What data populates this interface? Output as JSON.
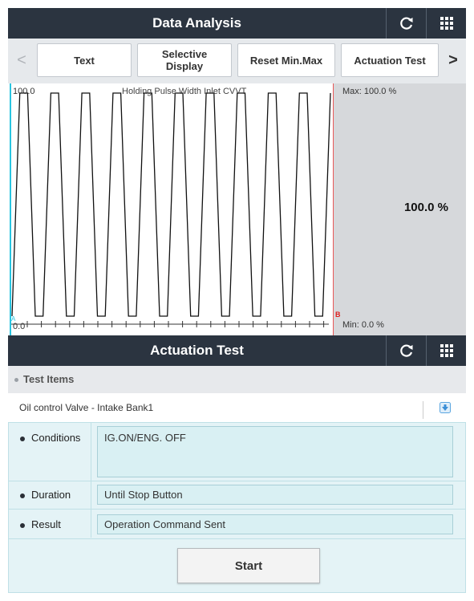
{
  "header": {
    "title": "Data Analysis"
  },
  "tabs": {
    "items": [
      {
        "label": "Text"
      },
      {
        "label": "Selective Display"
      },
      {
        "label": "Reset Min.Max"
      },
      {
        "label": "Actuation Test"
      }
    ],
    "prev_arrow": "<",
    "next_arrow": ">"
  },
  "graph": {
    "title": "Holding Pulse Width Inlet CVVT",
    "y_max_label": "100.0",
    "y_min_label": "0.0",
    "marker_a": "A",
    "marker_b": "B",
    "max_label": "Max: 100.0 %",
    "min_label": "Min: 0.0 %",
    "current_value": "100.0 %"
  },
  "chart_data": {
    "type": "line",
    "title": "Holding Pulse Width Inlet CVVT",
    "ylim": [
      0,
      100
    ],
    "series": [
      {
        "name": "Holding Pulse Width Inlet CVVT",
        "values": [
          0,
          100,
          100,
          0,
          0,
          100,
          100,
          0,
          0,
          100,
          100,
          0,
          0,
          100,
          100,
          0,
          0,
          100,
          100,
          0,
          0,
          100,
          100,
          0,
          0,
          100,
          100,
          0,
          0,
          100,
          100,
          0,
          0,
          100,
          100,
          0,
          0,
          100,
          100,
          0,
          0,
          100
        ]
      }
    ]
  },
  "section": {
    "title": "Actuation Test"
  },
  "test_items": {
    "header": "Test Items",
    "selected": "Oil control Valve - Intake Bank1"
  },
  "details": {
    "conditions_label": "Conditions",
    "conditions_value": "IG.ON/ENG. OFF",
    "duration_label": "Duration",
    "duration_value": "Until Stop Button",
    "result_label": "Result",
    "result_value": "Operation Command Sent",
    "start_label": "Start"
  },
  "colors": {
    "header_bg": "#2b3440",
    "marker_a": "#29c4e0",
    "marker_b": "#e02020"
  }
}
